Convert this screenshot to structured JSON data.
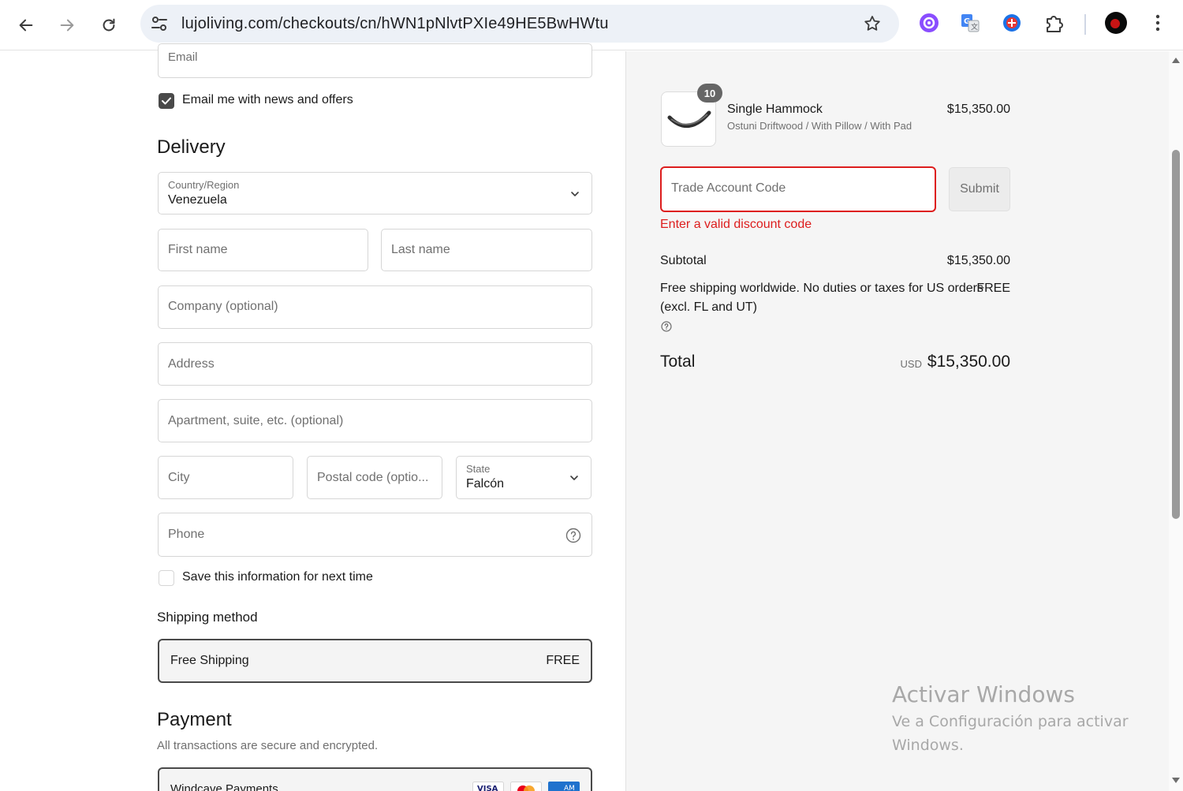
{
  "browser": {
    "url": "lujoliving.com/checkouts/cn/hWN1pNlvtPXIe49HE5BwHWtu"
  },
  "contact": {
    "email_placeholder": "Email",
    "newsletter_label": "Email me with news and offers",
    "newsletter_checked": true
  },
  "delivery": {
    "heading": "Delivery",
    "country_label": "Country/Region",
    "country_value": "Venezuela",
    "first_name_placeholder": "First name",
    "last_name_placeholder": "Last name",
    "company_placeholder": "Company (optional)",
    "address_placeholder": "Address",
    "apartment_placeholder": "Apartment, suite, etc. (optional)",
    "city_placeholder": "City",
    "postal_placeholder": "Postal code (optio...",
    "state_label": "State",
    "state_value": "Falcón",
    "phone_placeholder": "Phone",
    "save_info_label": "Save this information for next time",
    "save_info_checked": false
  },
  "shipping": {
    "heading": "Shipping method",
    "option_label": "Free Shipping",
    "option_price": "FREE"
  },
  "payment": {
    "heading": "Payment",
    "subtitle": "All transactions are secure and encrypted.",
    "provider": "Windcave Payments",
    "card_icons": [
      "visa-icon",
      "mastercard-icon",
      "amex-icon"
    ]
  },
  "summary": {
    "item": {
      "quantity": "10",
      "name": "Single Hammock",
      "variant": "Ostuni Driftwood / With Pillow / With Pad",
      "price": "$15,350.00"
    },
    "discount_placeholder": "Trade Account Code",
    "submit_label": "Submit",
    "error_text": "Enter a valid discount code",
    "subtotal_label": "Subtotal",
    "subtotal_value": "$15,350.00",
    "shipping_line1": "Free shipping worldwide. No duties or taxes for US orders",
    "shipping_line2": "(excl. FL and UT)",
    "shipping_value": "FREE",
    "total_label": "Total",
    "currency": "USD",
    "total_value": "$15,350.00"
  },
  "watermark": {
    "title": "Activar Windows",
    "subtitle": "Ve a Configuración para activar Windows."
  },
  "colors": {
    "error": "#dd1d1d",
    "summary_bg": "#f5f5f5",
    "omnibox_bg": "#edf1f7"
  }
}
